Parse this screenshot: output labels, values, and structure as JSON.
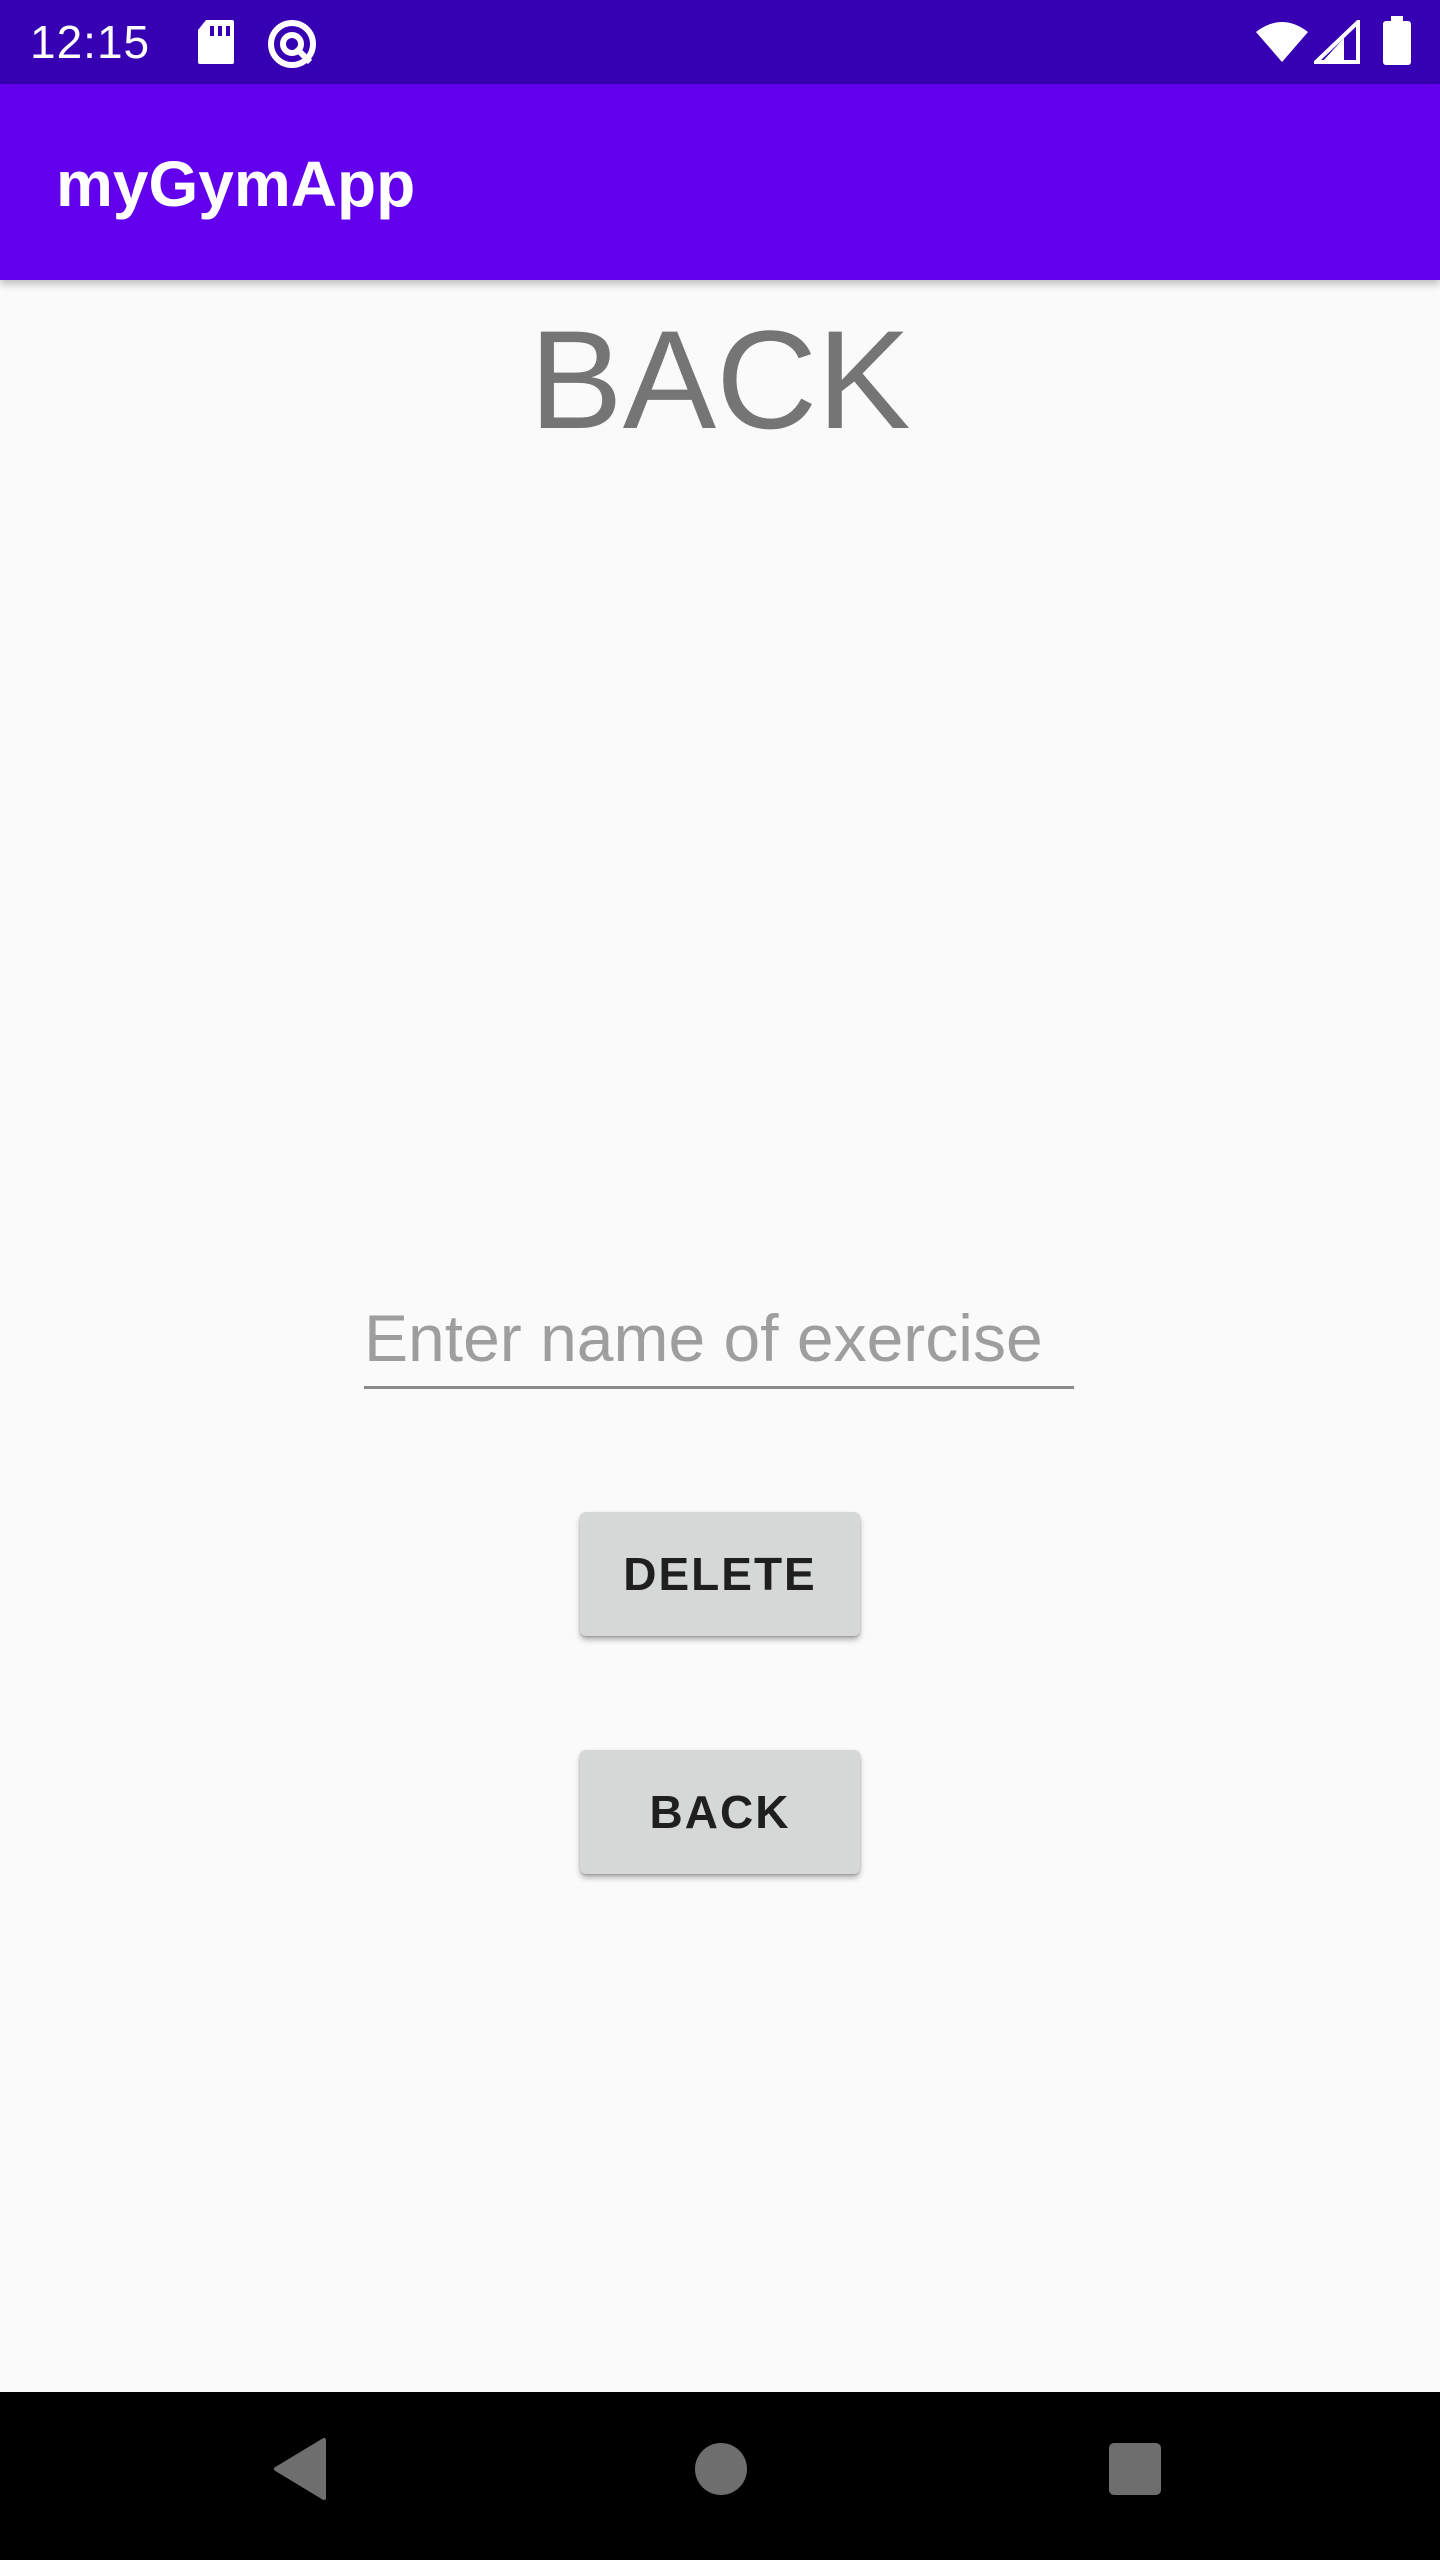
{
  "status_bar": {
    "time": "12:15",
    "icons": [
      "sd-card-icon",
      "vpn-icon",
      "wifi-icon",
      "signal-icon",
      "battery-icon"
    ]
  },
  "app_bar": {
    "title": "myGymApp",
    "color": "#6200ee"
  },
  "main": {
    "heading": "BACK",
    "exercise_input": {
      "value": "",
      "placeholder": "Enter name of exercise"
    },
    "delete_button_label": "DELETE",
    "back_button_label": "BACK"
  },
  "nav_bar": {
    "icons": [
      "back-triangle-icon",
      "home-circle-icon",
      "recents-square-icon"
    ]
  },
  "colors": {
    "status_bar": "#3700b3",
    "app_bar": "#6200ee",
    "background": "#fafafa",
    "button": "#d6d7d7",
    "heading_text": "#757575"
  }
}
